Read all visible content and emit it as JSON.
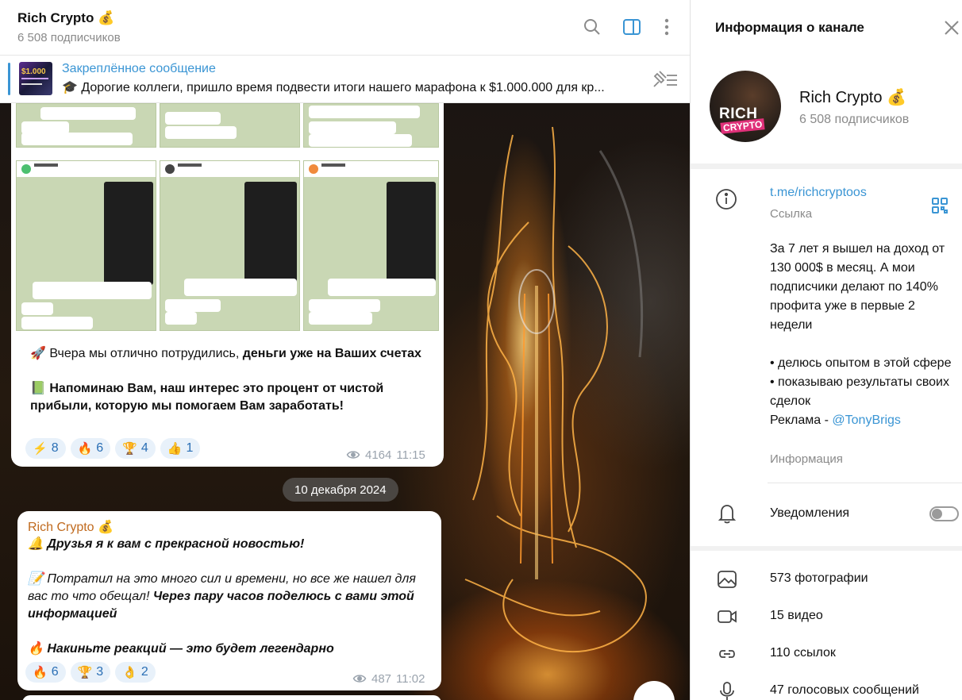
{
  "header": {
    "title": "Rich Crypto 💰",
    "subscribers": "6 508 подписчиков"
  },
  "pinned": {
    "title": "Закреплённое сообщение",
    "text": "🎓 Дорогие коллеги, пришло время подвести итоги нашего марафона к $1.000.000 для кр..."
  },
  "messages": [
    {
      "text1_prefix": "🚀 Вчера мы отлично потрудились, ",
      "text1_bold": "деньги уже на Ваших счетах",
      "text2": "📗 Напоминаю Вам, наш интерес это процент от чистой прибыли, которую мы помогаем Вам заработать!",
      "reactions": [
        {
          "emoji": "⚡",
          "count": "8"
        },
        {
          "emoji": "🔥",
          "count": "6"
        },
        {
          "emoji": "🏆",
          "count": "4"
        },
        {
          "emoji": "👍",
          "count": "1"
        }
      ],
      "views": "4164",
      "time": "11:15"
    },
    {
      "author": "Rich Crypto 💰",
      "line1": "🔔 Друзья я к вам с прекрасной новостью!",
      "line2_prefix": "📝 Потратил на это много сил и времени, но все же нашел для вас то что обещал! ",
      "line2_bold": "Через пару часов поделюсь с вами этой информацией",
      "line3": "🔥 Накиньте реакций — это будет легендарно",
      "reactions": [
        {
          "emoji": "🔥",
          "count": "6"
        },
        {
          "emoji": "🏆",
          "count": "3"
        },
        {
          "emoji": "👌",
          "count": "2"
        }
      ],
      "views": "487",
      "time": "11:02"
    }
  ],
  "date_separator": "10 декабря 2024",
  "info": {
    "title": "Информация о канале",
    "name": "Rich Crypto 💰",
    "subscribers": "6 508 подписчиков",
    "avatar_text_1": "RICH",
    "avatar_text_2": "CRYPTO",
    "link": "t.me/richcryptoos",
    "link_caption": "Ссылка",
    "desc_line1": "За 7 лет я вышел на доход от 130 000$ в месяц. А мои подписчики делают по 140% профита уже в первые 2 недели",
    "desc_bullet1": "• делюсь опытом в этой сфере",
    "desc_bullet2": "• показываю результаты своих сделок",
    "desc_ad_prefix": "Реклама - ",
    "desc_ad_handle": "@TonyBrigs",
    "desc_caption": "Информация",
    "notifications_label": "Уведомления",
    "notifications_on": false,
    "media": [
      {
        "icon": "photo-icon",
        "label": "573 фотографии"
      },
      {
        "icon": "video-icon",
        "label": "15 видео"
      },
      {
        "icon": "link-icon",
        "label": "110 ссылок"
      },
      {
        "icon": "microphone-icon",
        "label": "47 голосовых сообщений"
      }
    ]
  },
  "colors": {
    "accent": "#3a95d4",
    "author": "#c06a1e",
    "reaction_bg": "#e8f1fa",
    "muted": "#8a8a8a"
  }
}
